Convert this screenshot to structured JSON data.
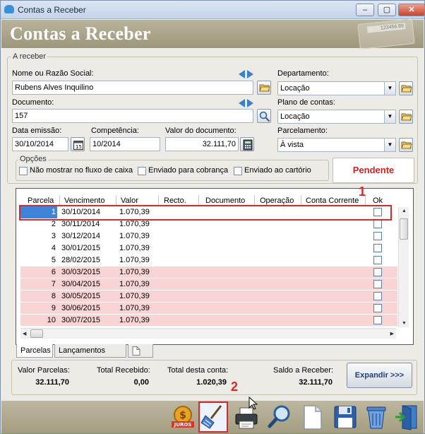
{
  "window": {
    "title": "Contas a Receber",
    "header_title": "Contas a Receber",
    "calc_display": "123456.89"
  },
  "section_receber": {
    "label": "A receber",
    "nome_label": "Nome ou Razão Social:",
    "nome_value": "Rubens Alves Inquilino",
    "documento_label": "Documento:",
    "documento_value": "157",
    "data_emissao_label": "Data emissão:",
    "data_emissao_value": "30/10/2014",
    "competencia_label": "Competência:",
    "competencia_value": "10/2014",
    "valor_doc_label": "Valor do documento:",
    "valor_doc_value": "32.111,70",
    "departamento_label": "Departamento:",
    "departamento_value": "Locação",
    "plano_label": "Plano de contas:",
    "plano_value": "Locação",
    "parcelamento_label": "Parcelamento:",
    "parcelamento_value": "À vista"
  },
  "opcoes": {
    "label": "Opções",
    "nao_mostrar": "Não mostrar no fluxo de caixa",
    "enviado_cobranca": "Enviado para cobrança",
    "enviado_cartorio": "Enviado ao cartório"
  },
  "status": "Pendente",
  "grid": {
    "columns": [
      "Parcela",
      "Vencimento",
      "Valor",
      "Recto.",
      "Documento",
      "Operação",
      "Conta Corrente",
      "Ok"
    ],
    "rows": [
      {
        "parcela": "1",
        "vencimento": "30/10/2014",
        "valor": "1.070,39"
      },
      {
        "parcela": "2",
        "vencimento": "30/11/2014",
        "valor": "1.070,39"
      },
      {
        "parcela": "3",
        "vencimento": "30/12/2014",
        "valor": "1.070,39"
      },
      {
        "parcela": "4",
        "vencimento": "30/01/2015",
        "valor": "1.070,39"
      },
      {
        "parcela": "5",
        "vencimento": "28/02/2015",
        "valor": "1.070,39"
      },
      {
        "parcela": "6",
        "vencimento": "30/03/2015",
        "valor": "1.070,39"
      },
      {
        "parcela": "7",
        "vencimento": "30/04/2015",
        "valor": "1.070,39"
      },
      {
        "parcela": "8",
        "vencimento": "30/05/2015",
        "valor": "1.070,39"
      },
      {
        "parcela": "9",
        "vencimento": "30/06/2015",
        "valor": "1.070,39"
      },
      {
        "parcela": "10",
        "vencimento": "30/07/2015",
        "valor": "1.070,39"
      }
    ]
  },
  "tabs": {
    "parcelas": "Parcelas",
    "lancamentos": "Lançamentos"
  },
  "summary": {
    "valor_parcelas_label": "Valor Parcelas:",
    "valor_parcelas": "32.111,70",
    "total_recebido_label": "Total Recebido:",
    "total_recebido": "0,00",
    "total_conta_label": "Total desta conta:",
    "total_conta": "1.020,39",
    "saldo_label": "Saldo a Receber:",
    "saldo": "32.111,70",
    "expand_label": "Expandir >>>"
  },
  "annotations": {
    "one": "1",
    "two": "2"
  },
  "toolbar": {
    "juros_label": "JUROS"
  },
  "colors": {
    "header": "#9d977c",
    "late_row": "#f9d4d4",
    "selected": "#3f84d8",
    "status": "#cc2222",
    "highlight": "#d42a2a"
  }
}
